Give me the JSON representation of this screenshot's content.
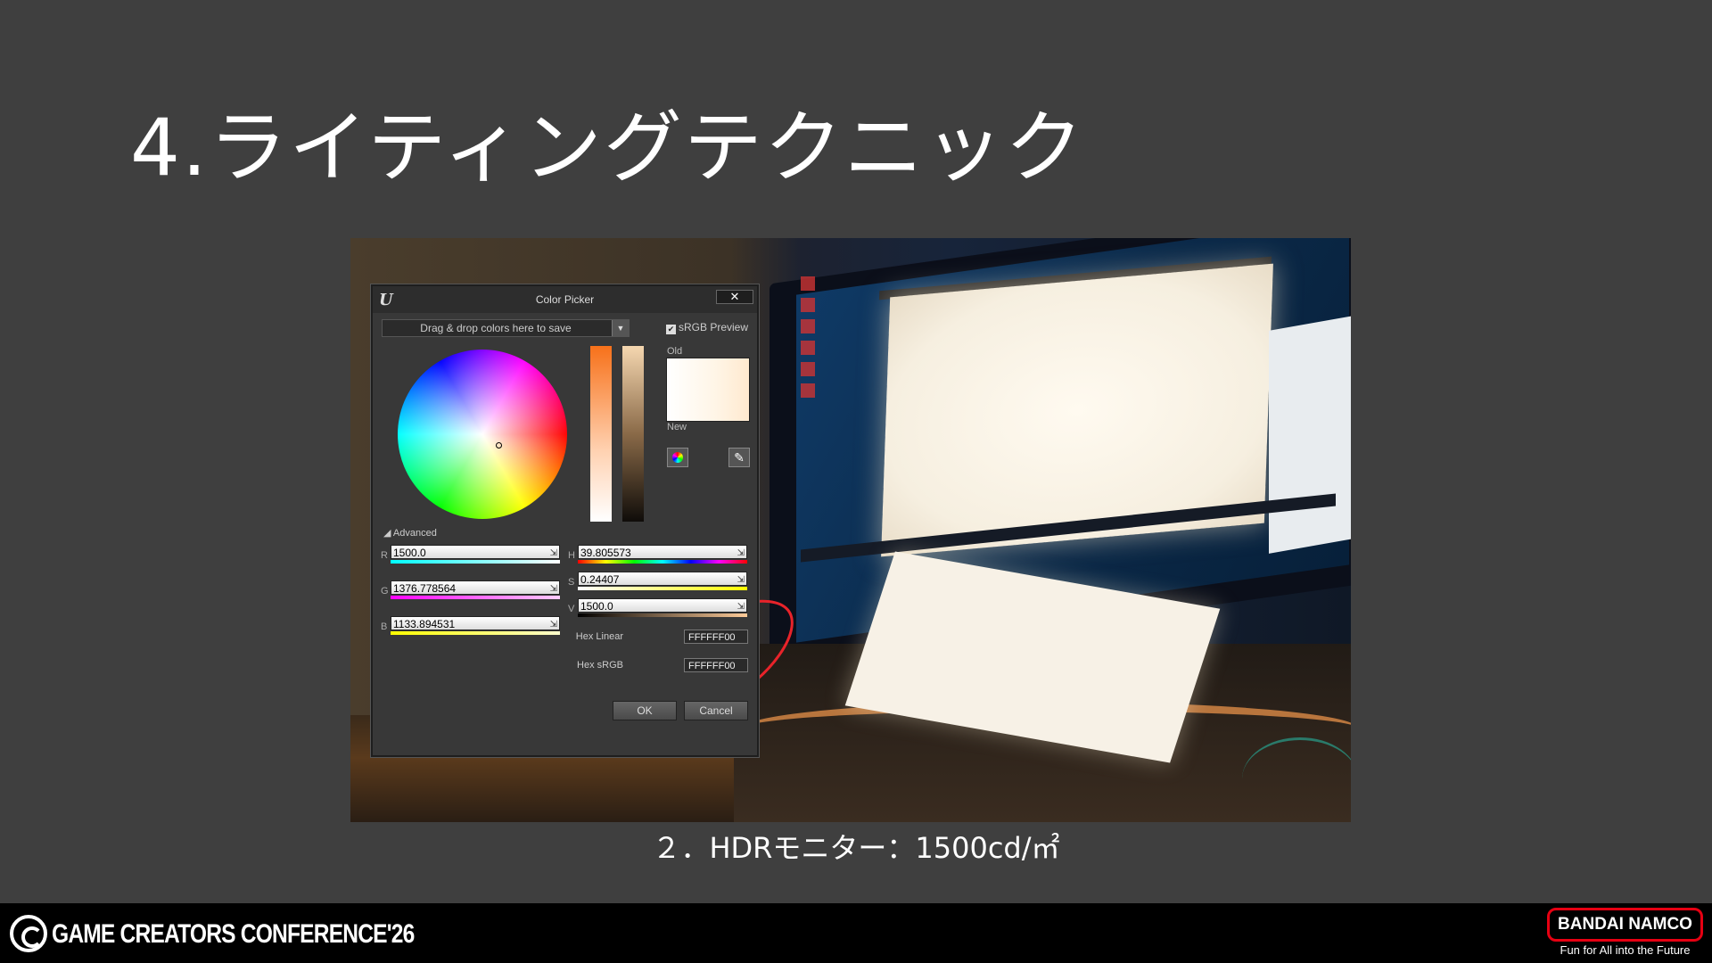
{
  "slide": {
    "title": "4.ライティングテクニック",
    "caption": "２．HDRモニター：1500cd/㎡"
  },
  "color_picker": {
    "window_title": "Color Picker",
    "close_glyph": "✕",
    "save_dropdown": "Drag & drop colors here to save",
    "srgb_preview_label": "sRGB Preview",
    "srgb_preview_checked": true,
    "old_label": "Old",
    "new_label": "New",
    "advanced_label": "Advanced",
    "fields": {
      "r": {
        "label": "R",
        "value": "1500.0"
      },
      "g": {
        "label": "G",
        "value": "1376.778564"
      },
      "b": {
        "label": "B",
        "value": "1133.894531"
      },
      "h": {
        "label": "H",
        "value": "39.805573"
      },
      "s": {
        "label": "S",
        "value": "0.24407"
      },
      "v": {
        "label": "V",
        "value": "1500.0"
      }
    },
    "hex_linear_label": "Hex Linear",
    "hex_linear_value": "FFFFFF00",
    "hex_srgb_label": "Hex sRGB",
    "hex_srgb_value": "FFFFFF00",
    "ok_label": "OK",
    "cancel_label": "Cancel",
    "icons": [
      "ue-logo-icon",
      "close-icon",
      "chevron-down-icon",
      "checkbox-icon",
      "color-wheel-icon",
      "eyedropper-icon"
    ]
  },
  "footer": {
    "conference": "GAME CREATORS CONFERENCE'26",
    "brand": "BANDAI NAMCO",
    "tagline": "Fun for All into the Future"
  },
  "colors": {
    "background": "#3f3f3f",
    "footer_bg": "#000000",
    "brand_red": "#e60012",
    "annotation_red": "#e8232a"
  }
}
